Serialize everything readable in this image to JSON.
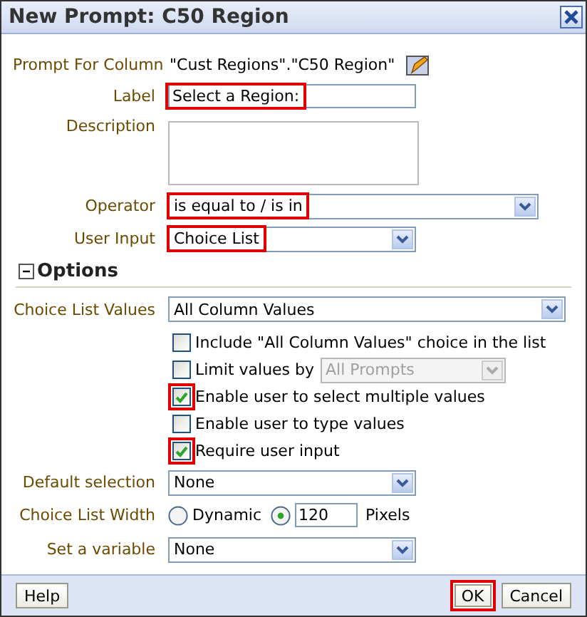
{
  "window": {
    "title": "New Prompt: C50 Region"
  },
  "fields": [
    {
      "kind": "static",
      "label": "Prompt For Column",
      "value": "\"Cust Regions\".\"C50 Region\""
    },
    {
      "kind": "text",
      "label": "Label",
      "value": "Select a Region:",
      "highlighted": true
    },
    {
      "kind": "textarea",
      "label": "Description"
    },
    {
      "kind": "select",
      "label": "Operator",
      "value": "is equal to / is in",
      "highlighted": true
    },
    {
      "kind": "select",
      "label": "User Input",
      "value": "Choice List",
      "highlighted": true
    }
  ],
  "options": {
    "title": "Options",
    "expanded": true,
    "rows": [
      {
        "kind": "select",
        "label": "Choice List Values",
        "value": "All Column Values"
      },
      {
        "kind": "checkbox",
        "label": "Include \"All Column Values\" choice in the list",
        "checked": false,
        "highlighted": false
      },
      {
        "kind": "checkbox",
        "label": "Limit values by",
        "checked": false,
        "highlighted": false,
        "select": {
          "value": "All Prompts",
          "disabled": true
        }
      },
      {
        "kind": "checkbox",
        "label": "Enable user to select multiple values",
        "checked": true,
        "highlighted": true
      },
      {
        "kind": "checkbox",
        "label": "Enable user to type values",
        "checked": false,
        "highlighted": false
      },
      {
        "kind": "checkbox",
        "label": "Require user input",
        "checked": true,
        "highlighted": true
      },
      {
        "kind": "select",
        "label": "Default selection",
        "value": "None"
      },
      {
        "kind": "width",
        "label": "Choice List Width",
        "radios": [
          {
            "label": "Dynamic",
            "selected": false
          },
          {
            "selected": true
          }
        ],
        "value": "120",
        "unit": "Pixels"
      },
      {
        "kind": "select",
        "label": "Set a variable",
        "value": "None"
      }
    ]
  },
  "buttons": [
    {
      "label": "Help",
      "highlighted": false
    },
    {
      "label": "OK",
      "highlighted": true
    },
    {
      "label": "Cancel",
      "highlighted": false
    }
  ]
}
